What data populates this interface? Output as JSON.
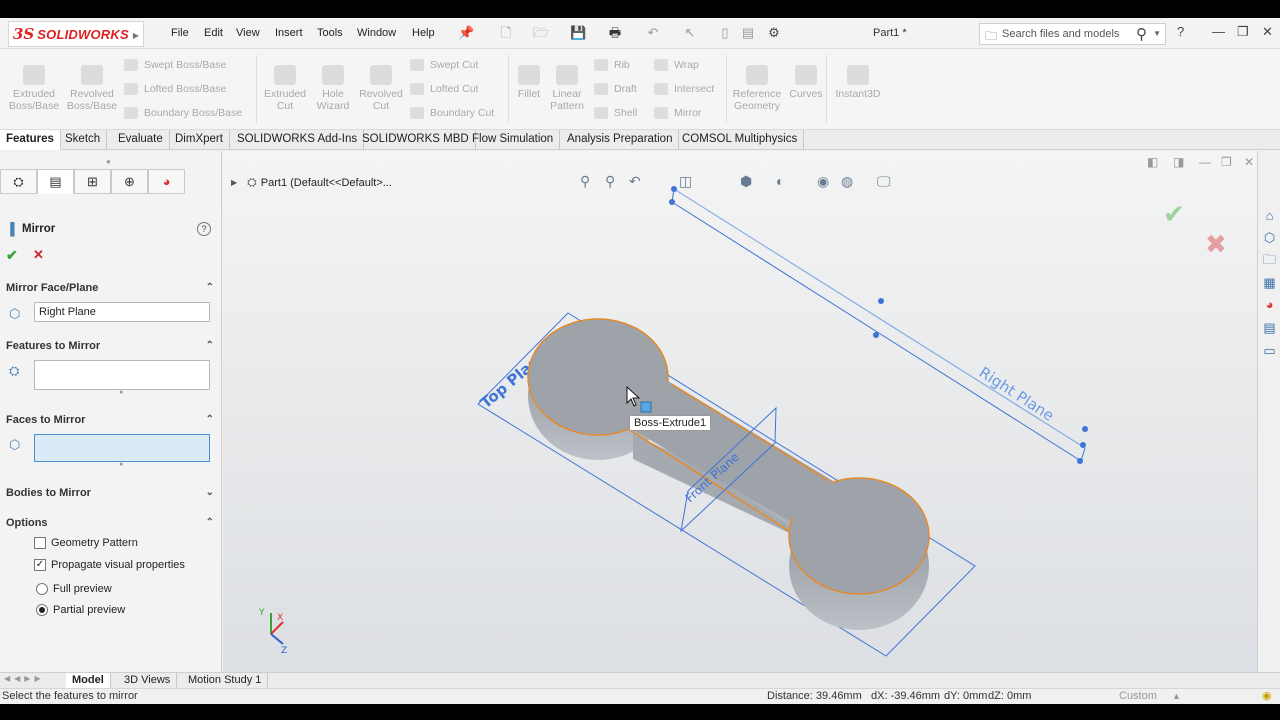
{
  "app": {
    "logo_prefix": "3S",
    "logo_text": "SOLIDWORKS",
    "document_title": "Part1 *"
  },
  "menu": [
    "File",
    "Edit",
    "View",
    "Insert",
    "Tools",
    "Window",
    "Help"
  ],
  "search": {
    "placeholder": "Search files and models"
  },
  "ribbon": {
    "extruded_boss": "Extruded Boss/Base",
    "revolved_boss": "Revolved Boss/Base",
    "swept_boss": "Swept Boss/Base",
    "lofted_boss": "Lofted Boss/Base",
    "boundary_boss": "Boundary Boss/Base",
    "extruded_cut": "Extruded Cut",
    "hole_wizard": "Hole Wizard",
    "revolved_cut": "Revolved Cut",
    "swept_cut": "Swept Cut",
    "lofted_cut": "Lofted Cut",
    "boundary_cut": "Boundary Cut",
    "fillet": "Fillet",
    "linear_pattern": "Linear Pattern",
    "rib": "Rib",
    "draft": "Draft",
    "shell": "Shell",
    "wrap": "Wrap",
    "intersect": "Intersect",
    "mirror": "Mirror",
    "reference_geometry": "Reference Geometry",
    "curves": "Curves",
    "instant3d": "Instant3D"
  },
  "tabs": [
    "Features",
    "Sketch",
    "Evaluate",
    "DimXpert",
    "SOLIDWORKS Add-Ins",
    "SOLIDWORKS MBD",
    "Flow Simulation",
    "Analysis Preparation",
    "COMSOL Multiphysics"
  ],
  "property_manager": {
    "title": "Mirror",
    "help": "?",
    "sections": {
      "mirror_face_plane": "Mirror Face/Plane",
      "features_to_mirror": "Features to Mirror",
      "faces_to_mirror": "Faces to Mirror",
      "bodies_to_mirror": "Bodies to Mirror",
      "options": "Options"
    },
    "mirror_plane_value": "Right Plane",
    "options": {
      "geometry_pattern": {
        "label": "Geometry Pattern",
        "checked": false
      },
      "propagate_visual": {
        "label": "Propagate visual properties",
        "checked": true
      },
      "full_preview": {
        "label": "Full preview",
        "selected": false
      },
      "partial_preview": {
        "label": "Partial preview",
        "selected": true
      }
    }
  },
  "viewport": {
    "tree_label": "Part1  (Default<<Default>...",
    "tooltip": "Boss-Extrude1",
    "plane_labels": {
      "top": "Top Plane",
      "front": "Front Plane",
      "right": "Right Plane"
    },
    "triad": {
      "x": "X",
      "y": "Y",
      "z": "Z"
    }
  },
  "bottom_tabs": [
    "Model",
    "3D Views",
    "Motion Study 1"
  ],
  "status": {
    "message": "Select the features to mirror",
    "distance": "Distance: 39.46mm",
    "dx": "dX: -39.46mm",
    "dy": "dY: 0mm",
    "dz": "dZ: 0mm",
    "units": "Custom"
  },
  "colors": {
    "plane_blue": "#3f73d6",
    "edge_orange": "#e58a2a",
    "accept_green": "#3aa335",
    "cancel_red": "#c9252c"
  }
}
